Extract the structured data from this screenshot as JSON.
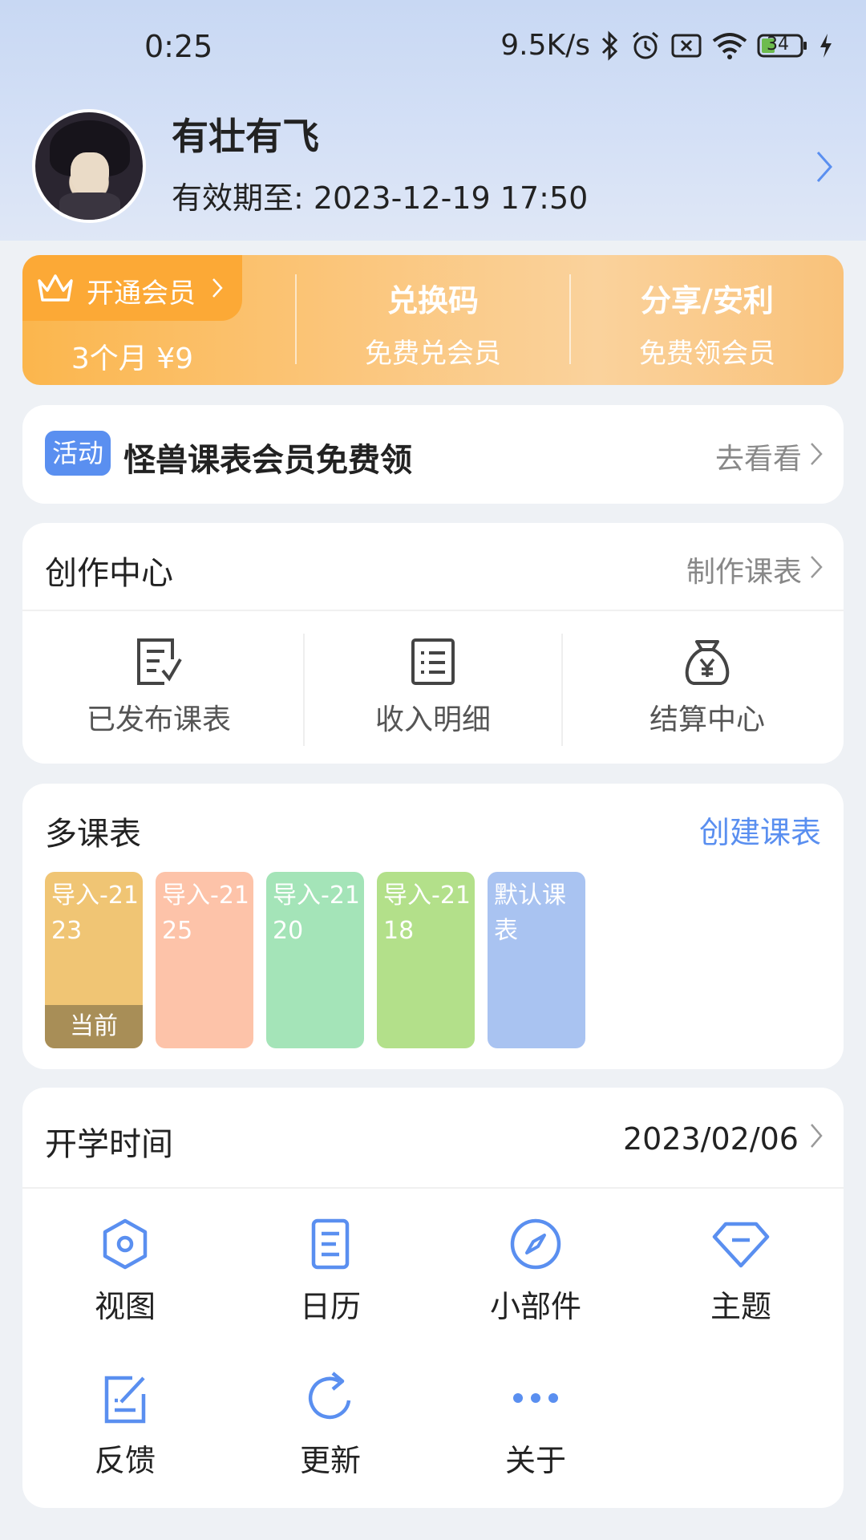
{
  "status_bar": {
    "time": "0:25",
    "network_speed": "9.5K/s",
    "battery_level": "34",
    "icons": [
      "bluetooth-icon",
      "alarm-icon",
      "no-sim-icon",
      "wifi-icon",
      "battery-icon",
      "charging-icon"
    ]
  },
  "profile": {
    "username": "有壮有飞",
    "expiry": "有效期至: 2023-12-19 17:50"
  },
  "vip_banner": {
    "open_label": "开通会员",
    "price": "3个月 ¥9",
    "redeem_title": "兑换码",
    "redeem_subtitle": "免费兑会员",
    "share_title": "分享/安利",
    "share_subtitle": "免费领会员"
  },
  "activity": {
    "badge": "活动",
    "title": "怪兽课表会员免费领",
    "link": "去看看"
  },
  "creation_center": {
    "title": "创作中心",
    "link": "制作课表",
    "items": [
      {
        "label": "已发布课表",
        "icon": "published-icon"
      },
      {
        "label": "收入明细",
        "icon": "list-icon"
      },
      {
        "label": "结算中心",
        "icon": "money-bag-icon"
      }
    ]
  },
  "multi_schedule": {
    "title": "多课表",
    "create_link": "创建课表",
    "current_label": "当前",
    "schedules": [
      {
        "name": "导入-2123",
        "color": "#f0c574"
      },
      {
        "name": "导入-2125",
        "color": "#fdc3a9"
      },
      {
        "name": "导入-2120",
        "color": "#a4e4b8"
      },
      {
        "name": "导入-2118",
        "color": "#b3e08a"
      },
      {
        "name": "默认课表",
        "color": "#a9c3f1"
      }
    ]
  },
  "start_time": {
    "title": "开学时间",
    "date": "2023/02/06"
  },
  "grid_menu": [
    {
      "label": "视图",
      "icon": "hexagon-icon"
    },
    {
      "label": "日历",
      "icon": "calendar-doc-icon"
    },
    {
      "label": "小部件",
      "icon": "compass-icon"
    },
    {
      "label": "主题",
      "icon": "diamond-icon"
    },
    {
      "label": "反馈",
      "icon": "edit-icon"
    },
    {
      "label": "更新",
      "icon": "refresh-icon"
    },
    {
      "label": "关于",
      "icon": "more-icon"
    }
  ],
  "colors": {
    "accent": "#5a8ff0",
    "vip_orange": "#fca936",
    "current_tag": "#a88e57"
  }
}
